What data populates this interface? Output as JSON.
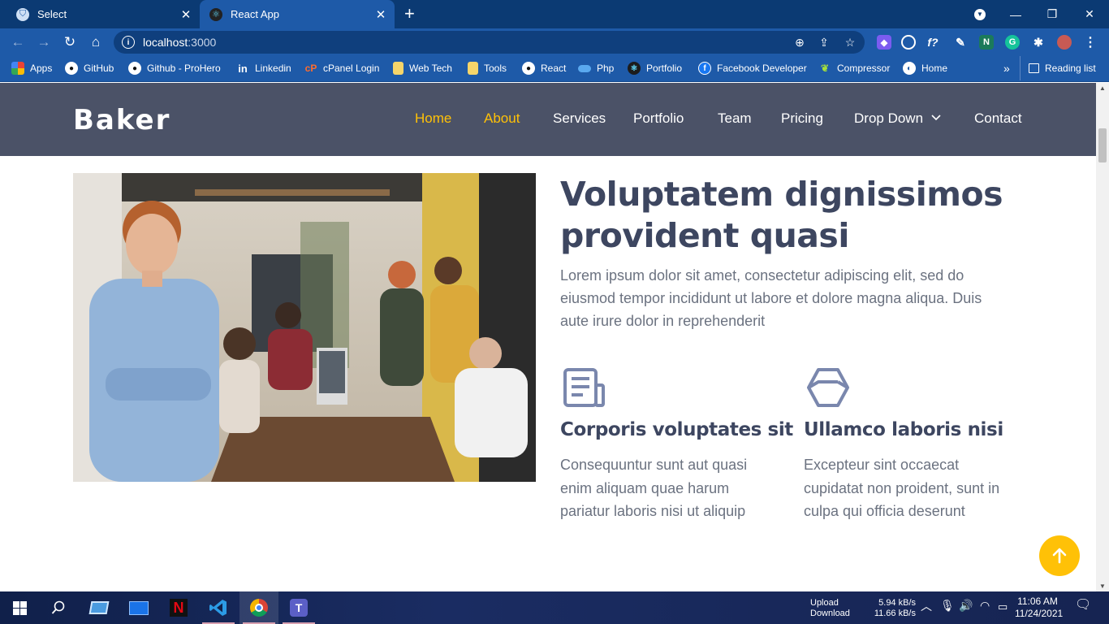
{
  "browser": {
    "tabs": [
      {
        "title": "Select",
        "active": false
      },
      {
        "title": "React App",
        "active": true
      }
    ],
    "url": {
      "host": "localhost",
      "port": ":3000"
    },
    "bookmarks": [
      {
        "label": "Apps",
        "icon": "apps-grid-icon"
      },
      {
        "label": "GitHub",
        "icon": "github-icon"
      },
      {
        "label": "Github - ProHero",
        "icon": "github-icon"
      },
      {
        "label": "Linkedin",
        "icon": "linkedin-icon"
      },
      {
        "label": "cPanel Login",
        "icon": "cpanel-icon"
      },
      {
        "label": "Web Tech",
        "icon": "folder-icon"
      },
      {
        "label": "Tools",
        "icon": "folder-icon"
      },
      {
        "label": "React",
        "icon": "github-icon"
      },
      {
        "label": "Php",
        "icon": "cloud-icon"
      },
      {
        "label": "Portfolio",
        "icon": "react-icon"
      },
      {
        "label": "Facebook Developer",
        "icon": "facebook-icon"
      },
      {
        "label": "Compressor",
        "icon": "compressor-icon"
      },
      {
        "label": "Home",
        "icon": "home-globe-icon"
      }
    ],
    "overflow": "»",
    "reading_list": "Reading list"
  },
  "site": {
    "logo": "Baker",
    "nav": [
      {
        "label": "Home",
        "active": true
      },
      {
        "label": "About",
        "active": true
      },
      {
        "label": "Services",
        "active": false
      },
      {
        "label": "Portfolio",
        "active": false
      },
      {
        "label": "Team",
        "active": false
      },
      {
        "label": "Pricing",
        "active": false
      },
      {
        "label": "Drop Down",
        "active": false
      },
      {
        "label": "Contact",
        "active": false
      }
    ],
    "accent_color": "#ffc107",
    "header_bg": "#4b5267"
  },
  "about": {
    "headline_line1": "Voluptatem dignissimos",
    "headline_line2": "provident quasi",
    "lead_lines": [
      "Lorem ipsum dolor sit amet, consectetur adipiscing elit, sed do",
      "eiusmod tempor incididunt ut labore et dolore magna aliqua. Duis",
      "aute irure dolor in reprehenderit"
    ],
    "features": [
      {
        "icon": "document-icon",
        "title": "Corporis voluptates sit",
        "lines": [
          "Consequuntur sunt aut quasi",
          "enim aliquam quae harum",
          "pariatur laboris nisi ut aliquip"
        ]
      },
      {
        "icon": "cube-icon",
        "title": "Ullamco laboris nisi",
        "lines": [
          "Excepteur sint occaecat",
          "cupidatat non proident, sunt in",
          "culpa qui officia deserunt"
        ]
      }
    ]
  },
  "taskbar": {
    "net_labels": [
      "Upload",
      "Download"
    ],
    "net_values": [
      "5.94 kB/s",
      "11.66 kB/s"
    ],
    "time": "11:06 AM",
    "date": "11/24/2021"
  }
}
